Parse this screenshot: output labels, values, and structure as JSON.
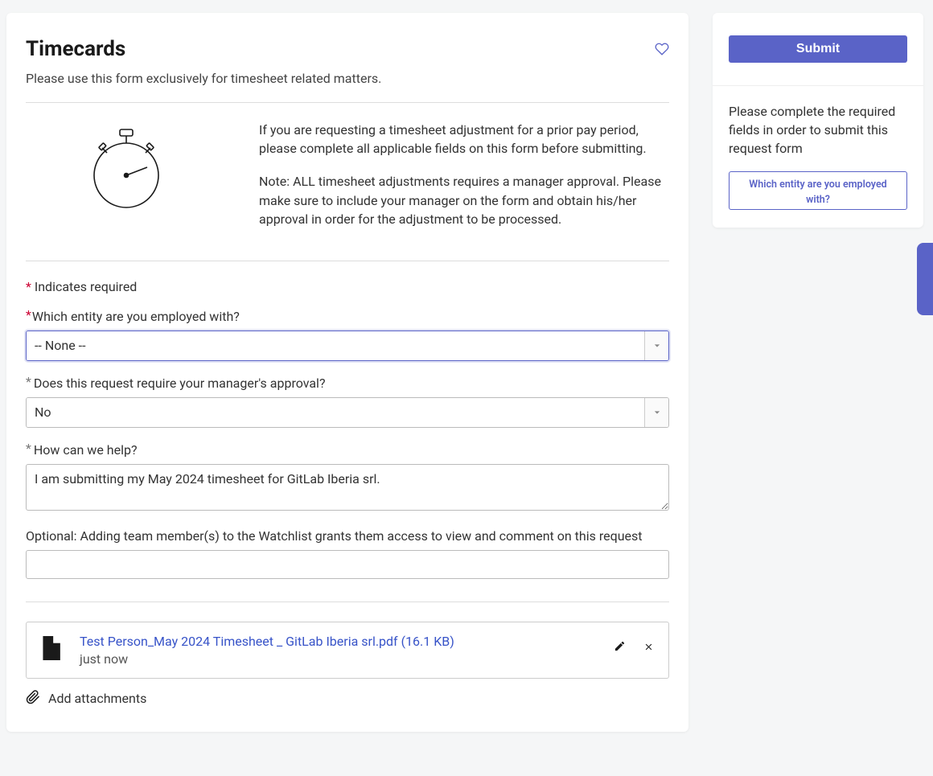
{
  "header": {
    "title": "Timecards",
    "subtitle": "Please use this form exclusively for timesheet related matters."
  },
  "intro": {
    "paragraph1": "If you are requesting a timesheet adjustment for a prior pay period, please complete all applicable fields on this form before submitting.",
    "paragraph2": "Note: ALL timesheet adjustments requires a manager approval. Please make sure to include your manager on the form and obtain his/her approval in order for the adjustment to be processed."
  },
  "required_note": "Indicates required",
  "fields": {
    "entity": {
      "label": "Which entity are you employed with?",
      "value": "-- None --"
    },
    "manager_approval": {
      "label": "Does this request require your manager's approval?",
      "value": "No"
    },
    "help": {
      "label": "How can we help?",
      "value": "I am submitting my May 2024 timesheet for GitLab Iberia srl."
    },
    "watchlist": {
      "label": "Optional: Adding team member(s) to the Watchlist grants them access to view and comment on this request",
      "value": ""
    }
  },
  "attachment": {
    "name": "Test Person_May 2024 Timesheet _ GitLab Iberia srl.pdf (16.1 KB)",
    "time": "just now"
  },
  "add_attachments_label": "Add attachments",
  "sidebar": {
    "submit_label": "Submit",
    "message": "Please complete the required fields in order to submit this request form",
    "required_link": "Which entity are you employed with?"
  }
}
